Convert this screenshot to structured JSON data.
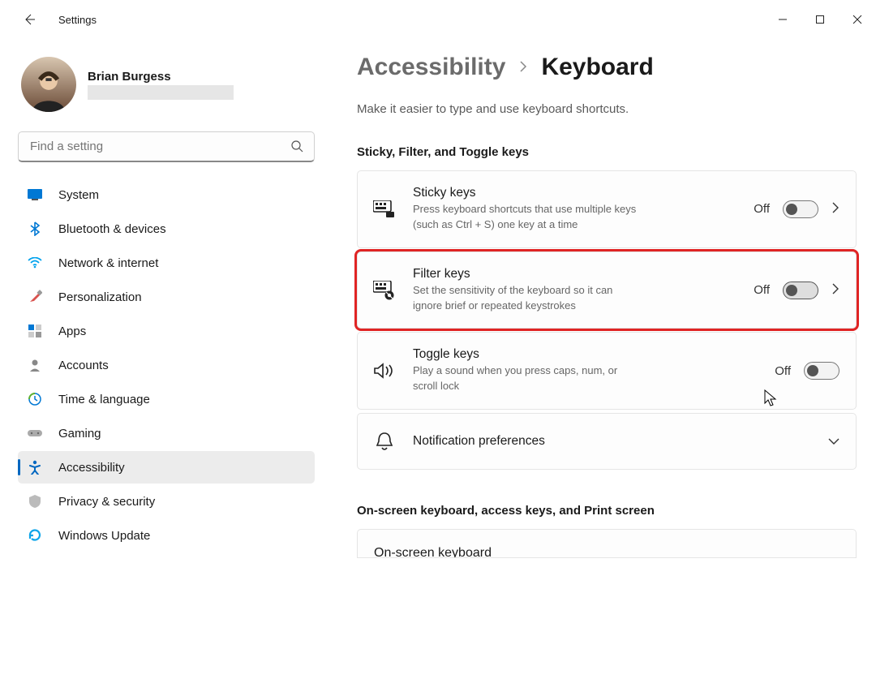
{
  "app_title": "Settings",
  "user": {
    "name": "Brian Burgess"
  },
  "search": {
    "placeholder": "Find a setting"
  },
  "nav": [
    {
      "label": "System"
    },
    {
      "label": "Bluetooth & devices"
    },
    {
      "label": "Network & internet"
    },
    {
      "label": "Personalization"
    },
    {
      "label": "Apps"
    },
    {
      "label": "Accounts"
    },
    {
      "label": "Time & language"
    },
    {
      "label": "Gaming"
    },
    {
      "label": "Accessibility"
    },
    {
      "label": "Privacy & security"
    },
    {
      "label": "Windows Update"
    }
  ],
  "breadcrumb": {
    "parent": "Accessibility",
    "current": "Keyboard"
  },
  "subtitle": "Make it easier to type and use keyboard shortcuts.",
  "section1": {
    "title": "Sticky, Filter, and Toggle keys",
    "sticky": {
      "title": "Sticky keys",
      "desc": "Press keyboard shortcuts that use multiple keys (such as Ctrl + S) one key at a time",
      "state": "Off"
    },
    "filter": {
      "title": "Filter keys",
      "desc": "Set the sensitivity of the keyboard so it can ignore brief or repeated keystrokes",
      "state": "Off"
    },
    "toggle": {
      "title": "Toggle keys",
      "desc": "Play a sound when you press caps, num, or scroll lock",
      "state": "Off"
    },
    "notif": {
      "title": "Notification preferences"
    }
  },
  "section2": {
    "title": "On-screen keyboard, access keys, and Print screen",
    "osk": {
      "title": "On-screen keyboard"
    }
  }
}
